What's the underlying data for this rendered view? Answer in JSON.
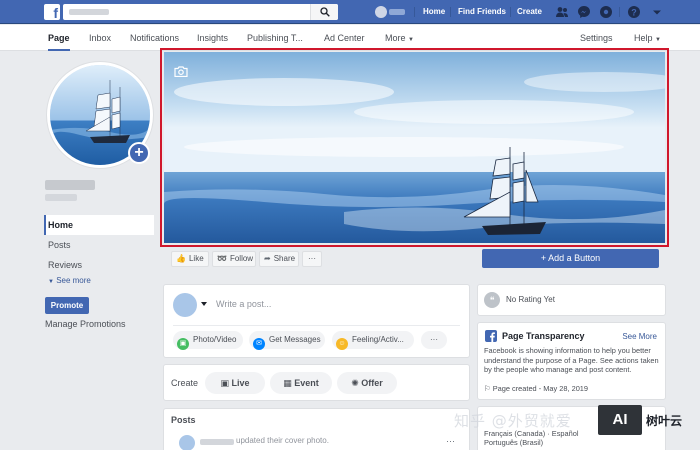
{
  "topbar": {
    "logo": "f",
    "links": [
      "Home",
      "Find Friends",
      "Create"
    ],
    "icons": [
      "friends-icon",
      "messenger-icon",
      "notifications-icon",
      "help-icon",
      "menu-caret-icon"
    ],
    "brand_color": "#4267b2"
  },
  "nav": {
    "tabs": [
      "Page",
      "Inbox",
      "Notifications",
      "Insights",
      "Publishing T...",
      "Ad Center",
      "More"
    ],
    "settings": "Settings",
    "help": "Help"
  },
  "sidebar": {
    "items": [
      "Home",
      "Posts",
      "Reviews"
    ],
    "see_more": "See more",
    "promote": "Promote",
    "manage": "Manage Promotions"
  },
  "actions": {
    "like": "Like",
    "follow": "Follow",
    "share": "Share",
    "more": "···",
    "add_button": "+ Add a Button"
  },
  "composer": {
    "placeholder": "Write a post...",
    "options": [
      "Photo/Video",
      "Get Messages",
      "Feeling/Activ...",
      "···"
    ]
  },
  "create": {
    "label": "Create",
    "buttons": [
      "Live",
      "Event",
      "Offer"
    ]
  },
  "posts": {
    "title": "Posts",
    "first_text": "updated their cover photo.",
    "more": "···"
  },
  "rating": {
    "text": "No Rating Yet"
  },
  "transparency": {
    "title": "Page Transparency",
    "see_more": "See More",
    "body": "Facebook is showing information to help you better understand the purpose of a Page. See actions taken by the people who manage and post content.",
    "created": "Page created - May 28, 2019",
    "langs1": "Français (Canada) · Español",
    "langs2": "Português (Brasil)"
  },
  "watermark": {
    "text": "知乎 @外贸就爱",
    "logo": "AI",
    "brand": "树叶云"
  }
}
